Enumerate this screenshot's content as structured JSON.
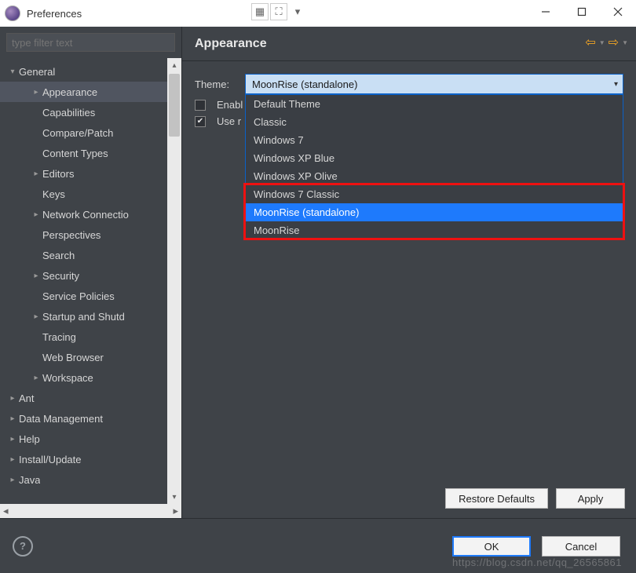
{
  "window": {
    "title": "Preferences"
  },
  "filter": {
    "placeholder": "type filter text"
  },
  "tree": {
    "general": {
      "label": "General"
    },
    "children": [
      "Appearance",
      "Capabilities",
      "Compare/Patch",
      "Content Types",
      "Editors",
      "Keys",
      "Network Connectio",
      "Perspectives",
      "Search",
      "Security",
      "Service Policies",
      "Startup and Shutd",
      "Tracing",
      "Web Browser",
      "Workspace"
    ],
    "roots_after": [
      "Ant",
      "Data Management",
      "Help",
      "Install/Update",
      "Java"
    ],
    "selected_index": 0,
    "expandable_children": [
      0,
      4,
      6,
      9,
      11,
      14
    ]
  },
  "page": {
    "title": "Appearance",
    "theme_label": "Theme:",
    "theme_value": "MoonRise (standalone)",
    "enable_label": "Enabl",
    "use_label": "Use r",
    "options": [
      "Default Theme",
      "Classic",
      "Windows 7",
      "Windows XP Blue",
      "Windows XP Olive",
      "Windows 7 Classic",
      "MoonRise (standalone)",
      "MoonRise"
    ],
    "selected_option_index": 6
  },
  "buttons": {
    "restore": "Restore Defaults",
    "apply": "Apply",
    "ok": "OK",
    "cancel": "Cancel"
  },
  "watermark": "https://blog.csdn.net/qq_26565861"
}
